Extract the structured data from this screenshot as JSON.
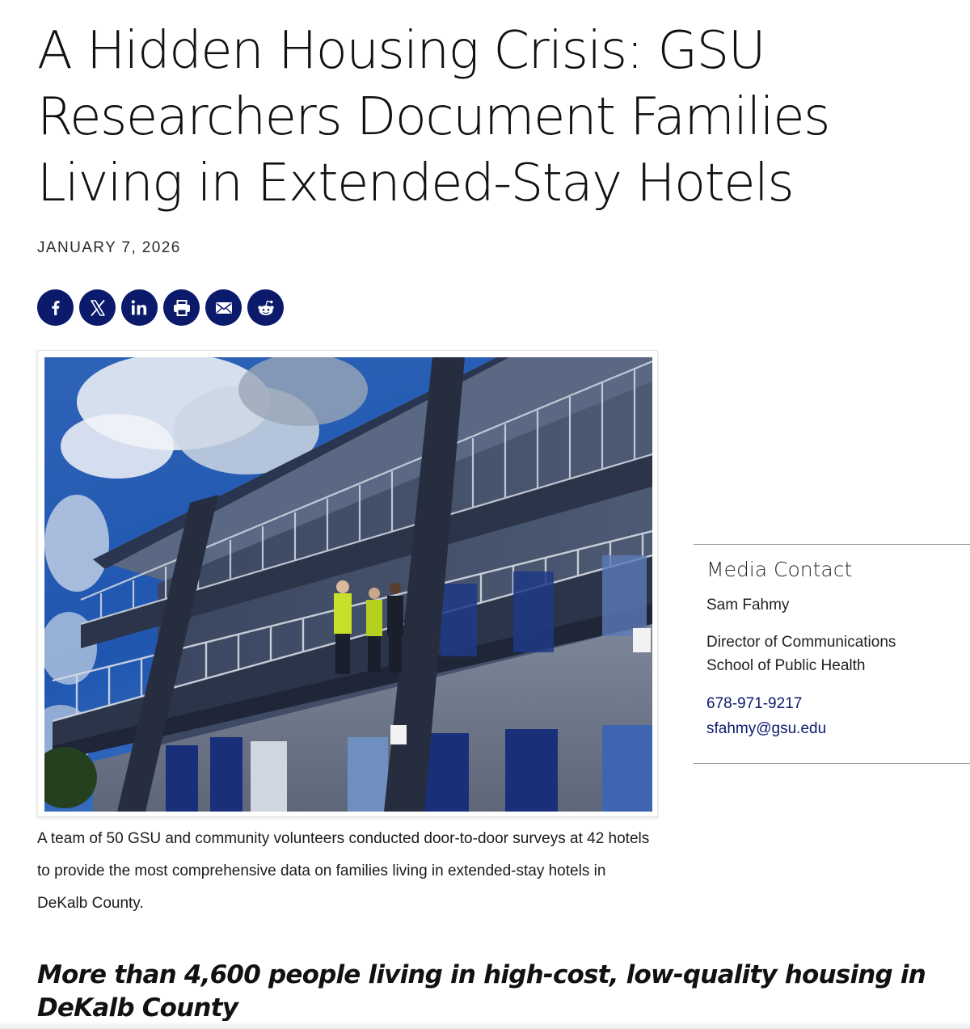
{
  "article": {
    "headline": "A Hidden Housing Crisis: GSU Researchers Document Families Living in Extended-Stay Hotels",
    "date": "JANUARY 7, 2026",
    "caption": "A team of 50 GSU and community volunteers conducted door-to-door surveys at 42 hotels to provide the most comprehensive data on families living in extended-stay hotels in DeKalb County.",
    "subheading": "More than 4,600 people living in high-cost, low-quality housing in DeKalb County"
  },
  "share": {
    "icons": [
      "facebook-icon",
      "x-icon",
      "linkedin-icon",
      "print-icon",
      "email-icon",
      "reddit-icon"
    ],
    "color": "#0b1a6b"
  },
  "media_contact": {
    "heading": "Media Contact",
    "name": "Sam Fahmy",
    "title_line1": "Director of Communications",
    "title_line2": "School of Public Health",
    "phone": "678-971-9217",
    "email": "sfahmy@gsu.edu"
  },
  "colors": {
    "brand_navy": "#0b1a6b",
    "text": "#1a1a1a"
  }
}
